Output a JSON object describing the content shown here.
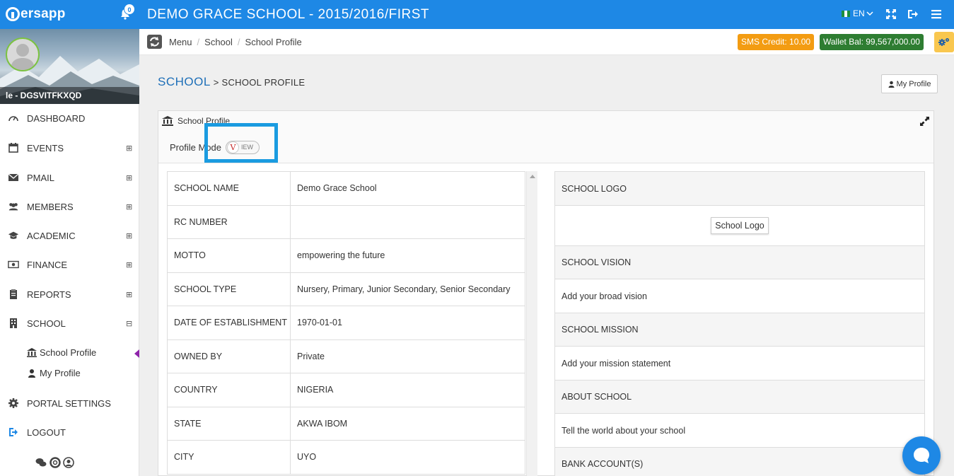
{
  "app": {
    "logo_text": "ersapp",
    "notification_count": "0",
    "title": "DEMO GRACE SCHOOL - 2015/2016/FIRST",
    "language": "EN"
  },
  "sidebar": {
    "user_name": "le - DGSVITFKXQD",
    "items": [
      {
        "label": "DASHBOARD",
        "icon": "dashboard-icon",
        "toggle": ""
      },
      {
        "label": "EVENTS",
        "icon": "calendar-icon",
        "toggle": "⊞"
      },
      {
        "label": "PMAIL",
        "icon": "envelope-icon",
        "toggle": "⊞"
      },
      {
        "label": "MEMBERS",
        "icon": "users-icon",
        "toggle": "⊞"
      },
      {
        "label": "ACADEMIC",
        "icon": "graduation-cap-icon",
        "toggle": "⊞"
      },
      {
        "label": "FINANCE",
        "icon": "money-icon",
        "toggle": "⊞"
      },
      {
        "label": "REPORTS",
        "icon": "clipboard-icon",
        "toggle": "⊞"
      },
      {
        "label": "SCHOOL",
        "icon": "building-icon",
        "toggle": "⊟"
      },
      {
        "label": "PORTAL SETTINGS",
        "icon": "gear-icon",
        "toggle": ""
      },
      {
        "label": "LOGOUT",
        "icon": "sign-out-icon",
        "toggle": ""
      }
    ],
    "sub_items": [
      {
        "label": "School Profile",
        "icon": "bank-icon"
      },
      {
        "label": "My Profile",
        "icon": "user-icon"
      }
    ]
  },
  "breadcrumb": {
    "items": [
      "Menu",
      "School",
      "School Profile"
    ],
    "separator": "/"
  },
  "header_badges": {
    "sms_credit": "SMS Credit: 10.00",
    "wallet_balance": "Wallet Bal: 99,567,000.00"
  },
  "page": {
    "heading_main": "SCHOOL",
    "heading_sub": " > SCHOOL PROFILE",
    "my_profile_button": "My Profile"
  },
  "panel": {
    "title": "School Profile",
    "profile_mode_label": "Profile Mode",
    "toggle_knob": "V",
    "toggle_text": "IEW"
  },
  "school_details": [
    {
      "key": "SCHOOL NAME",
      "value": "Demo Grace School"
    },
    {
      "key": "RC NUMBER",
      "value": ""
    },
    {
      "key": "MOTTO",
      "value": "empowering the future"
    },
    {
      "key": "SCHOOL TYPE",
      "value": "Nursery, Primary, Junior Secondary, Senior Secondary"
    },
    {
      "key": "DATE OF ESTABLISHMENT",
      "value": "1970-01-01"
    },
    {
      "key": "OWNED BY",
      "value": "Private"
    },
    {
      "key": "COUNTRY",
      "value": "NIGERIA"
    },
    {
      "key": "STATE",
      "value": "AKWA IBOM"
    },
    {
      "key": "CITY",
      "value": "UYO"
    }
  ],
  "right_panel": {
    "logo_header": "SCHOOL LOGO",
    "logo_button": "School Logo",
    "vision_header": "SCHOOL VISION",
    "vision_text": "Add your broad vision",
    "mission_header": "SCHOOL MISSION",
    "mission_text": "Add your mission statement",
    "about_header": "ABOUT SCHOOL",
    "about_text": "Tell the world about your school",
    "bank_header": "BANK ACCOUNT(S)"
  },
  "colors": {
    "topbar": "#1e88e5",
    "sms_badge": "#f39c12",
    "wallet_badge": "#2e7d32",
    "heading_blue": "#1e6fb8",
    "highlight": "#1a9be0"
  }
}
